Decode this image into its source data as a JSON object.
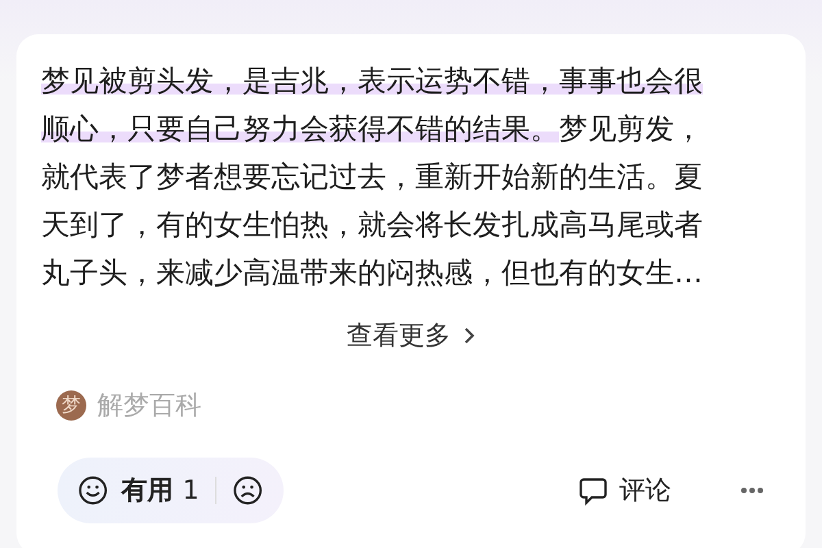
{
  "content": {
    "lines": [
      {
        "marked": "梦见被剪头发，是吉兆，表示运势不错，事事也会很"
      },
      {
        "marked": "顺心，只要自己努力会获得不错的结果。",
        "plain": "梦见剪发，"
      },
      {
        "plain": "就代表了梦者想要忘记过去，重新开始新的生活。夏"
      },
      {
        "plain": "天到了，有的女生怕热，就会将长发扎成高马尾或者"
      },
      {
        "plain": "丸子头，来减少高温带来的闷热感，但也有的女生…"
      }
    ]
  },
  "more_link": "查看更多",
  "source": {
    "avatar_text": "梦",
    "name": "解梦百科"
  },
  "actions": {
    "useful_label": "有用",
    "useful_count": "1",
    "comment_label": "评论"
  }
}
